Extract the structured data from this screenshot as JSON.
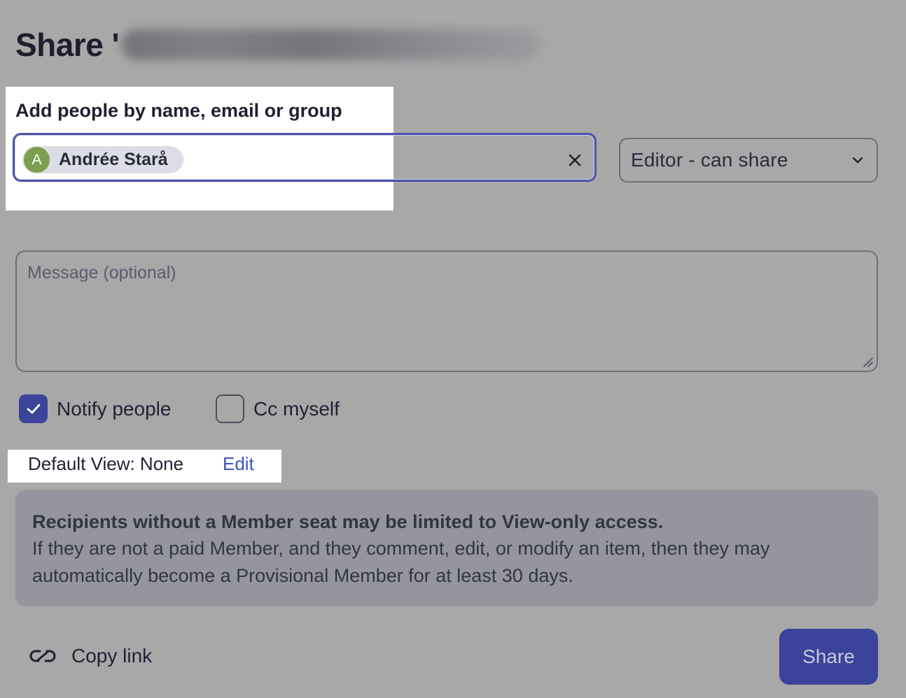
{
  "dialog": {
    "title_prefix": "Share '"
  },
  "people": {
    "label": "Add people by name, email or group",
    "chip": {
      "initial": "A",
      "name": "Andrée Starå"
    }
  },
  "role": {
    "selected": "Editor - can share"
  },
  "message": {
    "placeholder": "Message (optional)"
  },
  "options": {
    "notify_label": "Notify people",
    "notify_checked": true,
    "cc_label": "Cc myself",
    "cc_checked": false
  },
  "default_view": {
    "text": "Default View: None",
    "edit_label": "Edit"
  },
  "notice": {
    "title": "Recipients without a Member seat may be limited to View-only access.",
    "body": "If they are not a paid Member, and they comment, edit, or modify an item, then they may automatically become a Provisional Member for at least 30 days."
  },
  "footer": {
    "copy_link_label": "Copy link",
    "share_label": "Share"
  },
  "colors": {
    "accent": "#3b439a",
    "link": "#3b55b8",
    "avatar": "#7c9e4f",
    "overlay": "#a8a8a8"
  },
  "icons": {
    "clear": "close-icon",
    "dropdown": "chevron-down-icon",
    "checkbox": "checkmark-icon",
    "copy_link": "link-icon"
  }
}
